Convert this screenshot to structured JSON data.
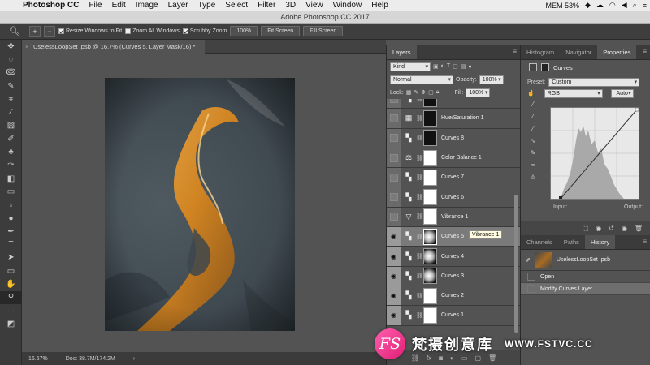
{
  "menubar": {
    "app": "Photoshop CC",
    "items": [
      "File",
      "Edit",
      "Image",
      "Layer",
      "Type",
      "Select",
      "Filter",
      "3D",
      "View",
      "Window",
      "Help"
    ],
    "status": {
      "mem": "MEM 53%",
      "time": "≡"
    }
  },
  "window_title": "Adobe Photoshop CC 2017",
  "options": {
    "resize_label": "Resize Windows to Fit",
    "zoom_all_label": "Zoom All Windows",
    "scrubby_label": "Scrubby Zoom",
    "zoom_pct": "100%",
    "fit_screen": "Fit Screen",
    "fill_screen": "Fill Screen"
  },
  "document": {
    "tab_title": "UselessLoopSet .psb @ 16.7% (Curves 5, Layer Mask/16) *",
    "zoom": "16.67%",
    "doc_size": "Doc: 38.7M/174.2M"
  },
  "layers_panel": {
    "tab": "Layers",
    "filter_kind": "Kind",
    "blend_mode": "Normal",
    "opacity_label": "Opacity:",
    "opacity": "100%",
    "lock_label": "Lock:",
    "fill_label": "Fill:",
    "fill": "100%",
    "layers": [
      {
        "name": "",
        "visible": false,
        "icon": "curves-icon",
        "mask": "dark"
      },
      {
        "name": "Hue/Saturation 1",
        "visible": false,
        "icon": "hue-icon",
        "mask": "dark"
      },
      {
        "name": "Curves 8",
        "visible": false,
        "icon": "curves-icon",
        "mask": "dark"
      },
      {
        "name": "Color Balance 1",
        "visible": false,
        "icon": "balance-icon",
        "mask": "white"
      },
      {
        "name": "Curves 7",
        "visible": false,
        "icon": "curves-icon",
        "mask": "white"
      },
      {
        "name": "Curves 6",
        "visible": false,
        "icon": "curves-icon",
        "mask": "white"
      },
      {
        "name": "Vibrance 1",
        "visible": false,
        "icon": "vibrance-icon",
        "mask": "white"
      },
      {
        "name": "Curves 5",
        "visible": true,
        "icon": "curves-icon",
        "mask": "soft",
        "selected": true
      },
      {
        "name": "Curves 4",
        "visible": true,
        "icon": "curves-icon",
        "mask": "soft"
      },
      {
        "name": "Curves 3",
        "visible": true,
        "icon": "curves-icon",
        "mask": "soft"
      },
      {
        "name": "Curves 2",
        "visible": true,
        "icon": "curves-icon",
        "mask": "white"
      },
      {
        "name": "Curves 1",
        "visible": true,
        "icon": "curves-icon",
        "mask": "white"
      }
    ],
    "tooltip": "Vibrance 1"
  },
  "properties_panel": {
    "tabs": [
      "Histogram",
      "Navigator",
      "Properties"
    ],
    "active_tab": "Properties",
    "adjustment": "Curves",
    "preset_label": "Preset:",
    "preset": "Custom",
    "channel": "RGB",
    "auto": "Auto",
    "input_label": "Input:",
    "output_label": "Output:"
  },
  "history_panel": {
    "tabs": [
      "Channels",
      "Paths",
      "History"
    ],
    "active_tab": "History",
    "snapshot": "UselessLoopSet .psb",
    "items": [
      "Open",
      "Modify Curves Layer"
    ]
  },
  "watermark": {
    "logo": "FS",
    "cn": "梵摄创意库",
    "en": "WWW.FSTVC.CC"
  }
}
